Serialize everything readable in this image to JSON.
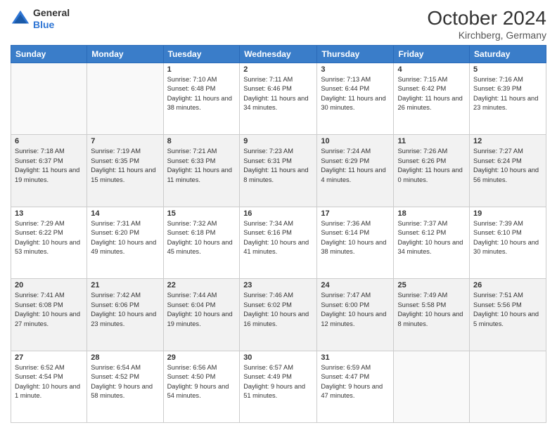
{
  "header": {
    "logo": {
      "general": "General",
      "blue": "Blue"
    },
    "month": "October 2024",
    "location": "Kirchberg, Germany"
  },
  "weekdays": [
    "Sunday",
    "Monday",
    "Tuesday",
    "Wednesday",
    "Thursday",
    "Friday",
    "Saturday"
  ],
  "weeks": [
    [
      {
        "day": "",
        "info": ""
      },
      {
        "day": "",
        "info": ""
      },
      {
        "day": "1",
        "info": "Sunrise: 7:10 AM\nSunset: 6:48 PM\nDaylight: 11 hours and 38 minutes."
      },
      {
        "day": "2",
        "info": "Sunrise: 7:11 AM\nSunset: 6:46 PM\nDaylight: 11 hours and 34 minutes."
      },
      {
        "day": "3",
        "info": "Sunrise: 7:13 AM\nSunset: 6:44 PM\nDaylight: 11 hours and 30 minutes."
      },
      {
        "day": "4",
        "info": "Sunrise: 7:15 AM\nSunset: 6:42 PM\nDaylight: 11 hours and 26 minutes."
      },
      {
        "day": "5",
        "info": "Sunrise: 7:16 AM\nSunset: 6:39 PM\nDaylight: 11 hours and 23 minutes."
      }
    ],
    [
      {
        "day": "6",
        "info": "Sunrise: 7:18 AM\nSunset: 6:37 PM\nDaylight: 11 hours and 19 minutes."
      },
      {
        "day": "7",
        "info": "Sunrise: 7:19 AM\nSunset: 6:35 PM\nDaylight: 11 hours and 15 minutes."
      },
      {
        "day": "8",
        "info": "Sunrise: 7:21 AM\nSunset: 6:33 PM\nDaylight: 11 hours and 11 minutes."
      },
      {
        "day": "9",
        "info": "Sunrise: 7:23 AM\nSunset: 6:31 PM\nDaylight: 11 hours and 8 minutes."
      },
      {
        "day": "10",
        "info": "Sunrise: 7:24 AM\nSunset: 6:29 PM\nDaylight: 11 hours and 4 minutes."
      },
      {
        "day": "11",
        "info": "Sunrise: 7:26 AM\nSunset: 6:26 PM\nDaylight: 11 hours and 0 minutes."
      },
      {
        "day": "12",
        "info": "Sunrise: 7:27 AM\nSunset: 6:24 PM\nDaylight: 10 hours and 56 minutes."
      }
    ],
    [
      {
        "day": "13",
        "info": "Sunrise: 7:29 AM\nSunset: 6:22 PM\nDaylight: 10 hours and 53 minutes."
      },
      {
        "day": "14",
        "info": "Sunrise: 7:31 AM\nSunset: 6:20 PM\nDaylight: 10 hours and 49 minutes."
      },
      {
        "day": "15",
        "info": "Sunrise: 7:32 AM\nSunset: 6:18 PM\nDaylight: 10 hours and 45 minutes."
      },
      {
        "day": "16",
        "info": "Sunrise: 7:34 AM\nSunset: 6:16 PM\nDaylight: 10 hours and 41 minutes."
      },
      {
        "day": "17",
        "info": "Sunrise: 7:36 AM\nSunset: 6:14 PM\nDaylight: 10 hours and 38 minutes."
      },
      {
        "day": "18",
        "info": "Sunrise: 7:37 AM\nSunset: 6:12 PM\nDaylight: 10 hours and 34 minutes."
      },
      {
        "day": "19",
        "info": "Sunrise: 7:39 AM\nSunset: 6:10 PM\nDaylight: 10 hours and 30 minutes."
      }
    ],
    [
      {
        "day": "20",
        "info": "Sunrise: 7:41 AM\nSunset: 6:08 PM\nDaylight: 10 hours and 27 minutes."
      },
      {
        "day": "21",
        "info": "Sunrise: 7:42 AM\nSunset: 6:06 PM\nDaylight: 10 hours and 23 minutes."
      },
      {
        "day": "22",
        "info": "Sunrise: 7:44 AM\nSunset: 6:04 PM\nDaylight: 10 hours and 19 minutes."
      },
      {
        "day": "23",
        "info": "Sunrise: 7:46 AM\nSunset: 6:02 PM\nDaylight: 10 hours and 16 minutes."
      },
      {
        "day": "24",
        "info": "Sunrise: 7:47 AM\nSunset: 6:00 PM\nDaylight: 10 hours and 12 minutes."
      },
      {
        "day": "25",
        "info": "Sunrise: 7:49 AM\nSunset: 5:58 PM\nDaylight: 10 hours and 8 minutes."
      },
      {
        "day": "26",
        "info": "Sunrise: 7:51 AM\nSunset: 5:56 PM\nDaylight: 10 hours and 5 minutes."
      }
    ],
    [
      {
        "day": "27",
        "info": "Sunrise: 6:52 AM\nSunset: 4:54 PM\nDaylight: 10 hours and 1 minute."
      },
      {
        "day": "28",
        "info": "Sunrise: 6:54 AM\nSunset: 4:52 PM\nDaylight: 9 hours and 58 minutes."
      },
      {
        "day": "29",
        "info": "Sunrise: 6:56 AM\nSunset: 4:50 PM\nDaylight: 9 hours and 54 minutes."
      },
      {
        "day": "30",
        "info": "Sunrise: 6:57 AM\nSunset: 4:49 PM\nDaylight: 9 hours and 51 minutes."
      },
      {
        "day": "31",
        "info": "Sunrise: 6:59 AM\nSunset: 4:47 PM\nDaylight: 9 hours and 47 minutes."
      },
      {
        "day": "",
        "info": ""
      },
      {
        "day": "",
        "info": ""
      }
    ]
  ]
}
